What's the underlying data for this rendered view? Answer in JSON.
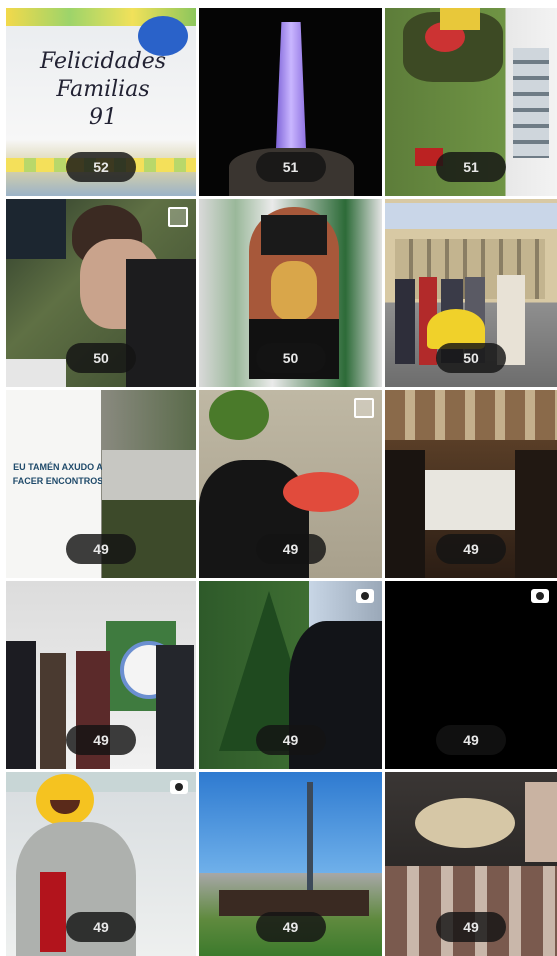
{
  "tiles": [
    {
      "count": "52",
      "overlay": "Felicidades\nFamilias\n91"
    },
    {
      "count": "51"
    },
    {
      "count": "51"
    },
    {
      "count": "50"
    },
    {
      "count": "50"
    },
    {
      "count": "50"
    },
    {
      "count": "49",
      "overlay": "EU TAMÉN AXUDO A\nFACER ENCONTROS"
    },
    {
      "count": "49"
    },
    {
      "count": "49"
    },
    {
      "count": "49"
    },
    {
      "count": "49"
    },
    {
      "count": "49"
    },
    {
      "count": "49"
    },
    {
      "count": "49"
    },
    {
      "count": "49"
    }
  ],
  "colors": {
    "badge_bg": "#1a1a1a",
    "badge_text": "#e8e8e8"
  }
}
